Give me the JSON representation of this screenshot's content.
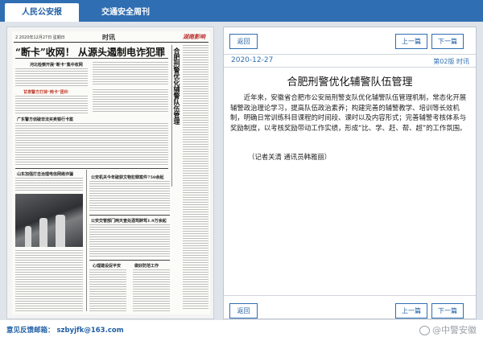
{
  "tabs": [
    {
      "label": "人民公安报",
      "active": true
    },
    {
      "label": "交通安全周刊",
      "active": false
    }
  ],
  "newspaper": {
    "page_label": "2  2020年12月27日 星期日",
    "section": "时讯",
    "logo": "湖南影响",
    "headline": "“断卡”收网！ 从源头遏制电诈犯罪",
    "subheads": [
      "河北检察开展“断卡”集中收网",
      "甘肃警方打掉“两卡”团伙",
      "广东警方侦破非法买卖银行卡案",
      "山东加强打击治理电信网络诈骗",
      "公安机关今年破获文物犯罪案件750余起",
      "公安交管部门两天查处酒驾醉驾1.9万余起",
      "心理建设促平安",
      "做好防范工作"
    ],
    "vertical_title": "合肥刑警优化辅警队伍管理"
  },
  "article": {
    "back_label": "返回",
    "prev_label": "上一篇",
    "next_label": "下一篇",
    "date": "2020-12-27",
    "page_info": "第02版 时讯",
    "title": "合肥刑警优化辅警队伍管理",
    "body": "近年来，安徽省合肥市公安局刑警支队优化辅警队伍管理机制，常态化开展辅警政治理论学习，提高队伍政治素养；构建完善的辅警教学、培训等长效机制，明确日常训练科目课程的时间段、课时以及内容形式；完善辅警考核体系与奖励制度，以考核奖励带动工作实绩，形成“比、学、赶、帮、超”的工作氛围。",
    "author": "（记者关清 通讯员韩雅丽）"
  },
  "footer": {
    "feedback": "意见反馈邮箱： szbyjfk@163.com",
    "watermark": "@中警安徽"
  },
  "colors": {
    "brand_blue": "#2f6eb2",
    "link_blue": "#1f5ea3"
  }
}
